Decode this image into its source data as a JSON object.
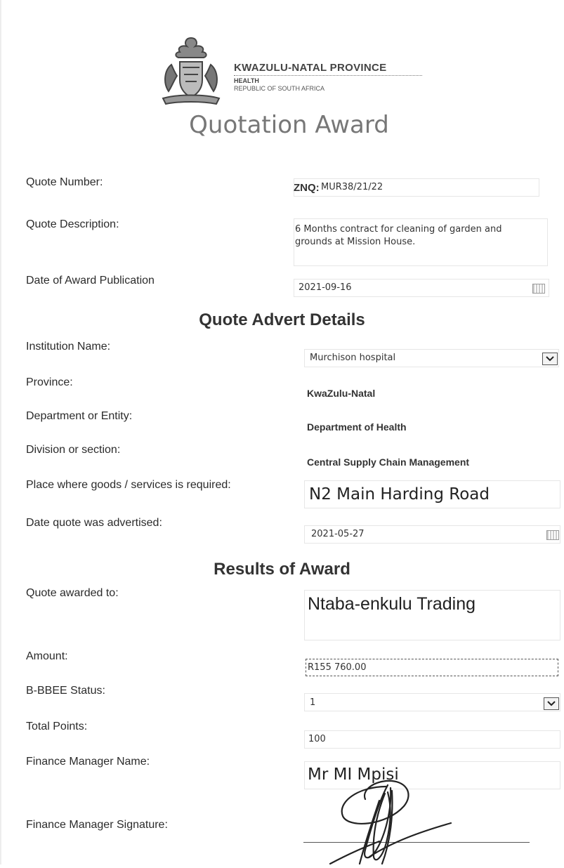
{
  "header": {
    "province": "KWAZULU-NATAL PROVINCE",
    "department": "HEALTH",
    "country": "REPUBLIC OF SOUTH AFRICA",
    "title": "Quotation Award"
  },
  "quote": {
    "number_label": "Quote Number:",
    "number_prefix": "ZNQ:",
    "number_value": "MUR38/21/22",
    "description_label": "Quote Description:",
    "description_value": "6 Months contract for cleaning of garden and grounds at Mission House.",
    "award_date_label": "Date of Award Publication",
    "award_date_value": "2021-09-16"
  },
  "advert": {
    "heading": "Quote Advert Details",
    "institution_label": "Institution Name:",
    "institution_value": "Murchison hospital",
    "province_label": "Province:",
    "province_value": "KwaZulu-Natal",
    "department_label": "Department or Entity:",
    "department_value": "Department of Health",
    "division_label": "Division or section:",
    "division_value": "Central Supply Chain Management",
    "place_label": "Place where goods /  services is required:",
    "place_value": "N2 Main Harding Road",
    "advertised_label": "Date quote was advertised:",
    "advertised_value": "2021-05-27"
  },
  "results": {
    "heading": "Results of Award",
    "awarded_label": "Quote awarded to:",
    "awarded_value": "Ntaba-enkulu Trading",
    "amount_label": "Amount:",
    "amount_value": "R155 760.00",
    "bbbee_label": "B-BBEE Status:",
    "bbbee_value": "1",
    "points_label": "Total Points:",
    "points_value": "100",
    "manager_label": "Finance Manager Name:",
    "manager_value": "Mr MI Mpisi",
    "signature_label": "Finance Manager Signature:"
  },
  "icons": {
    "coat_of_arms": "coat-of-arms-icon",
    "dropdown": "chevron-down-icon",
    "calendar": "calendar-icon"
  }
}
